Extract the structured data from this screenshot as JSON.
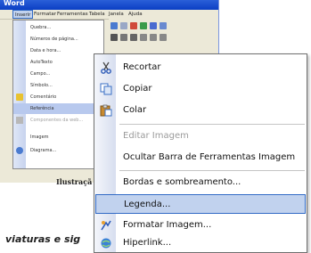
{
  "window": {
    "title": "Word"
  },
  "menubar": {
    "items": [
      "Inserir",
      "Formatar",
      "Ferramentas",
      "Tabela",
      "Janela",
      "Ajuda"
    ]
  },
  "submenu": {
    "items": [
      {
        "label": "Quebra...",
        "disabled": false
      },
      {
        "label": "Números de página...",
        "disabled": false
      },
      {
        "label": "Data e hora...",
        "disabled": false
      },
      {
        "label": "AutoTexto",
        "disabled": false
      },
      {
        "label": "Campo...",
        "disabled": false
      },
      {
        "label": "Símbolo...",
        "disabled": false
      },
      {
        "label": "Comentário",
        "disabled": false
      },
      {
        "label": "Referência",
        "disabled": false,
        "highlighted": true
      },
      {
        "label": "Componentes da web...",
        "disabled": true
      },
      {
        "label": "Imagem",
        "disabled": false
      },
      {
        "label": "Diagrama...",
        "disabled": false
      }
    ]
  },
  "document": {
    "caption": "Ilustraçã",
    "body_fragment": "viaturas e sig"
  },
  "context_menu": {
    "items": [
      {
        "label": "Recortar",
        "icon": "scissors-icon",
        "disabled": false
      },
      {
        "label": "Copiar",
        "icon": "copy-icon",
        "disabled": false
      },
      {
        "label": "Colar",
        "icon": "paste-icon",
        "disabled": false
      },
      {
        "label": "Editar Imagem",
        "icon": "",
        "disabled": true
      },
      {
        "label": "Ocultar Barra de Ferramentas Imagem",
        "icon": "",
        "disabled": false
      },
      {
        "label": "Bordas e sombreamento...",
        "icon": "",
        "disabled": false
      },
      {
        "label": "Legenda...",
        "icon": "",
        "disabled": false,
        "highlighted": true
      },
      {
        "label": "Formatar Imagem...",
        "icon": "format-picture-icon",
        "disabled": false
      },
      {
        "label": "Hiperlink...",
        "icon": "hyperlink-icon",
        "disabled": false
      }
    ]
  },
  "colors": {
    "highlight": "#c1d2ee",
    "highlight_border": "#316ac5",
    "titlebar": "#0b3fc4"
  }
}
